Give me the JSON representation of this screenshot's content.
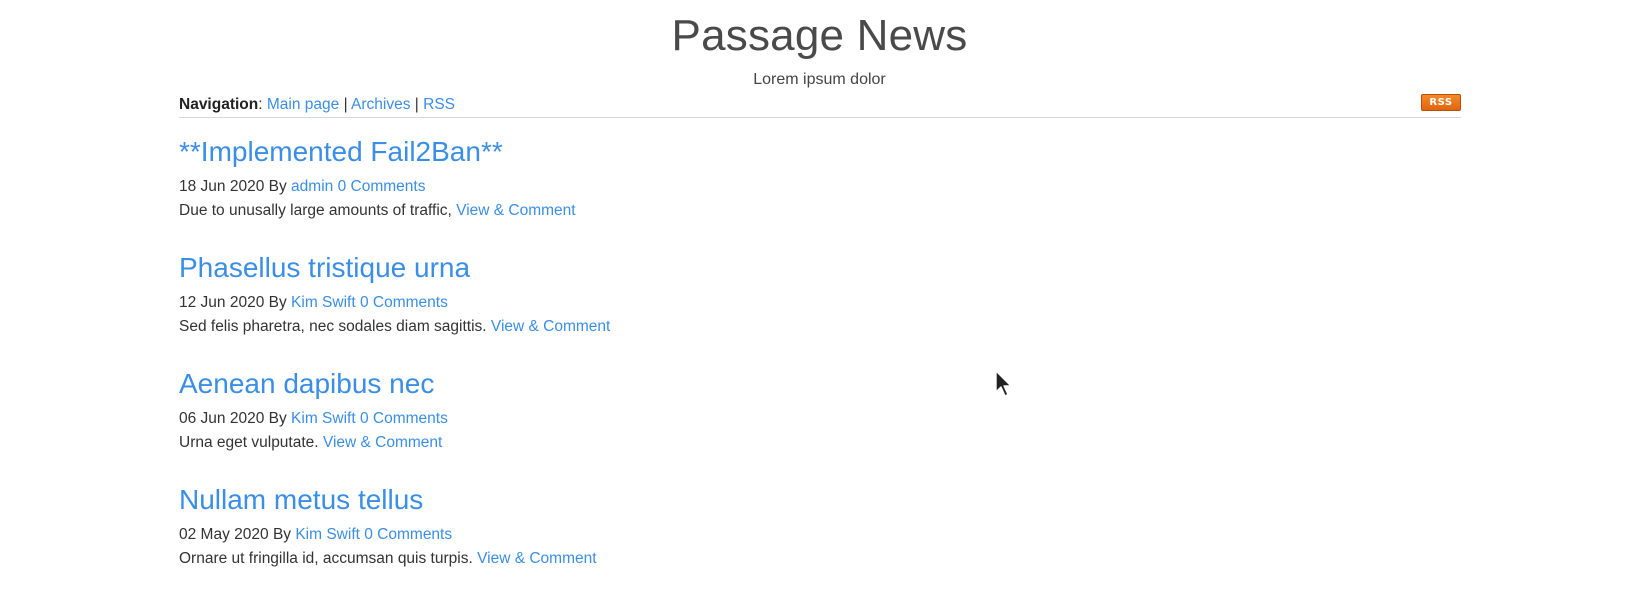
{
  "site": {
    "title": "Passage News",
    "tagline": "Lorem ipsum dolor"
  },
  "nav": {
    "label": "Navigation",
    "separator_colon": ":",
    "links": [
      "Main page",
      "Archives",
      "RSS"
    ],
    "separator": "|",
    "rss_badge": "RSS",
    "rss_badge_color": "#f07a1c"
  },
  "posts": [
    {
      "title": "**Implemented Fail2Ban**",
      "date": "18 Jun 2020",
      "by": "By",
      "author": "admin",
      "comments": "0 Comments",
      "excerpt": "Due to unusally large amounts of traffic,",
      "link": "View & Comment"
    },
    {
      "title": "Phasellus tristique urna",
      "date": "12 Jun 2020",
      "by": "By",
      "author": "Kim Swift",
      "comments": "0 Comments",
      "excerpt": "Sed felis pharetra, nec sodales diam sagittis.",
      "link": "View & Comment"
    },
    {
      "title": "Aenean dapibus nec",
      "date": "06 Jun 2020",
      "by": "By",
      "author": "Kim Swift",
      "comments": "0 Comments",
      "excerpt": "Urna eget vulputate.",
      "link": "View & Comment"
    },
    {
      "title": "Nullam metus tellus",
      "date": "02 May 2020",
      "by": "By",
      "author": "Kim Swift",
      "comments": "0 Comments",
      "excerpt": "Ornare ut fringilla id, accumsan quis turpis.",
      "link": "View & Comment"
    }
  ],
  "colors": {
    "link": "#3a8ee6",
    "text": "#333333",
    "title": "#4a4a4a"
  },
  "icons": {
    "cursor": "mouse-pointer-icon"
  }
}
